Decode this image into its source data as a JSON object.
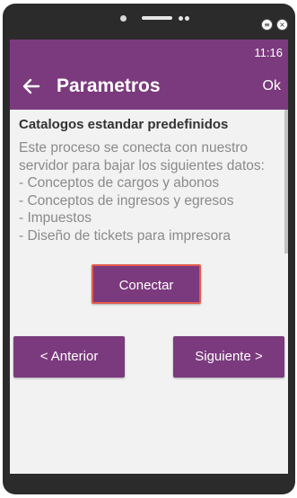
{
  "status_bar": {
    "time": "11:16"
  },
  "app_bar": {
    "title": "Parametros",
    "ok_label": "Ok"
  },
  "content": {
    "heading": "Catalogos estandar predefinidos",
    "description_lines": [
      "Este proceso se conecta con nuestro",
      "servidor para bajar los siguientes datos:",
      "- Conceptos de cargos y abonos",
      "- Conceptos de ingresos y egresos",
      "- Impuestos",
      "- Diseño de tickets para impresora"
    ]
  },
  "buttons": {
    "connect": "Conectar",
    "previous": "< Anterior",
    "next": "Siguiente >"
  },
  "window_controls": {
    "menu_icon": "≡",
    "close_icon": "×"
  },
  "colors": {
    "primary": "#7b3a7d",
    "connect_border": "#e25b4f",
    "background": "#f2f2f2"
  }
}
